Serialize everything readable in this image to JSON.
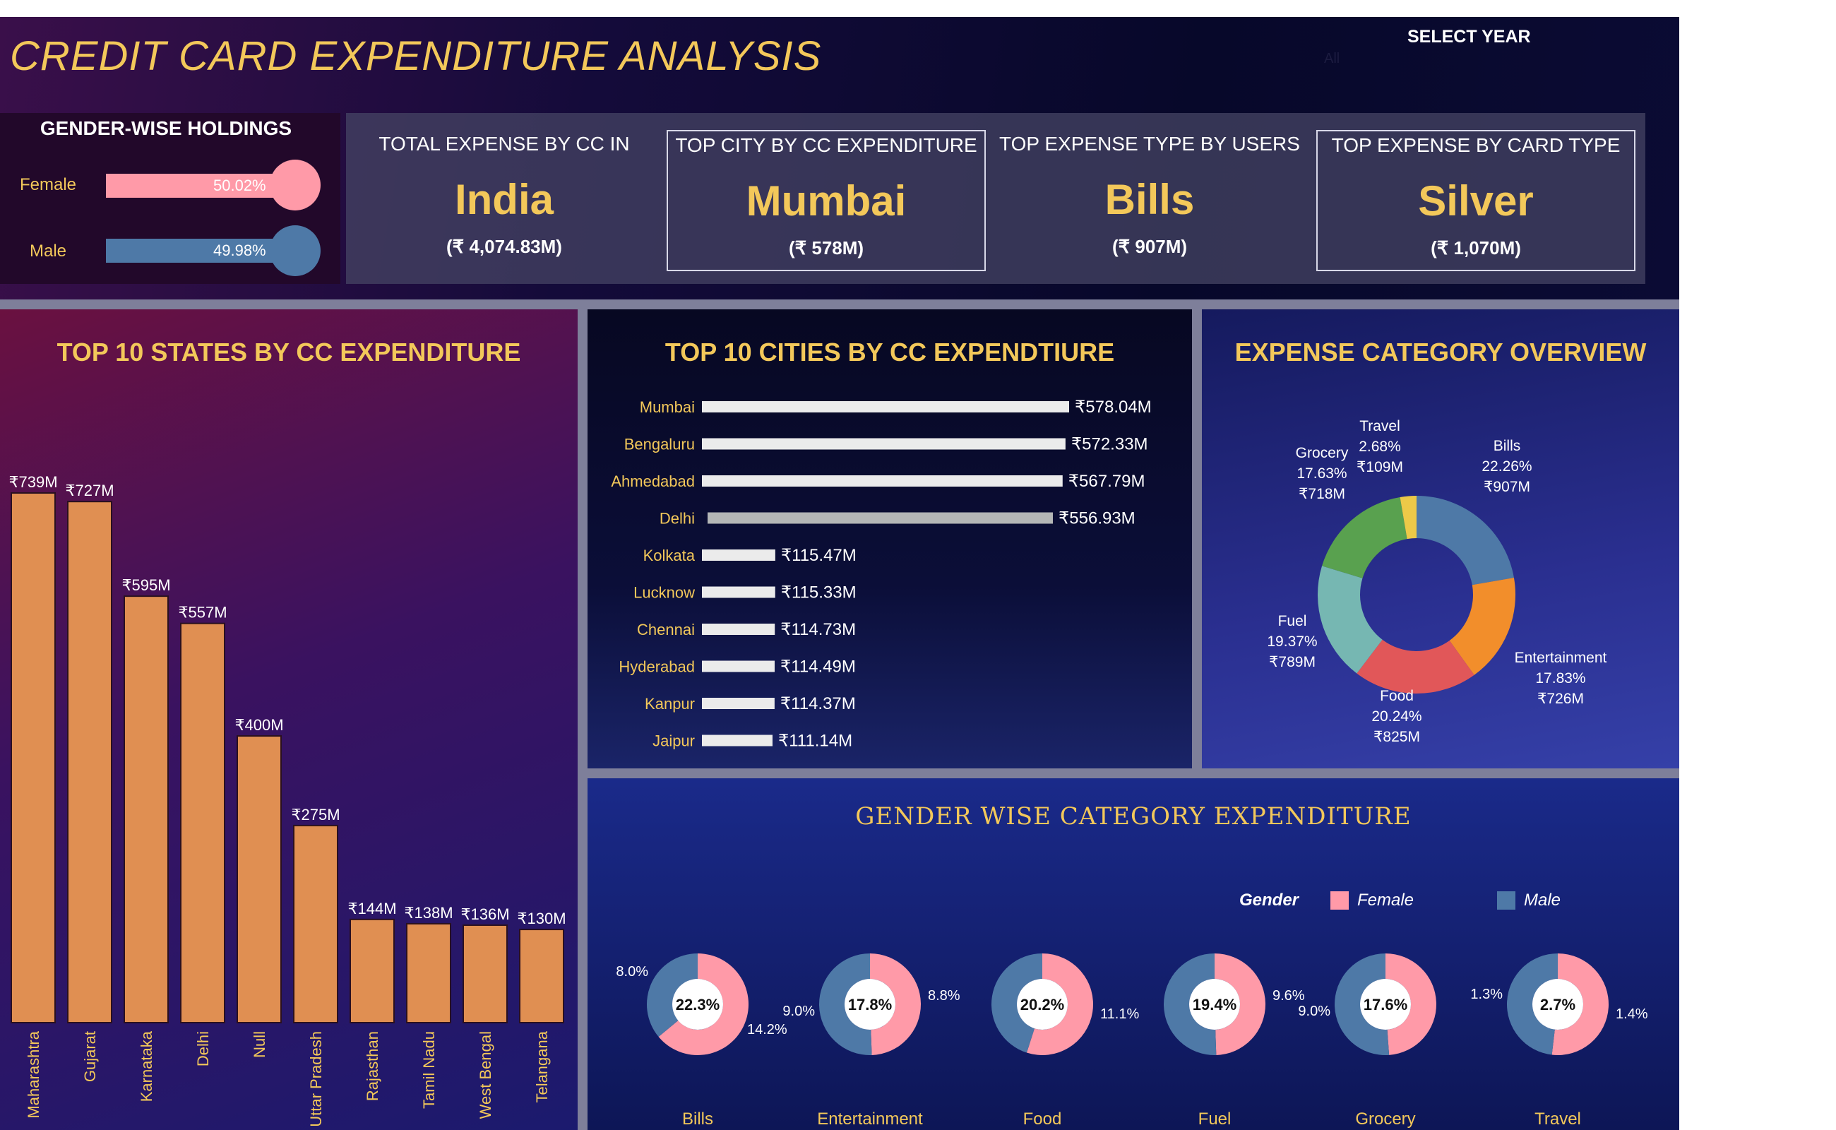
{
  "title": "CREDIT CARD EXPENDITURE ANALYSIS",
  "filter": {
    "label": "SELECT YEAR",
    "value": "All"
  },
  "gender_holdings": {
    "title": "GENDER-WISE HOLDINGS",
    "rows": [
      {
        "label": "Female",
        "pct_text": "50.02%",
        "value": 50.02,
        "color": "#ff9aa8"
      },
      {
        "label": "Male",
        "pct_text": "49.98%",
        "value": 49.98,
        "color": "#4e79a7"
      }
    ]
  },
  "kpis": [
    {
      "title": "TOTAL EXPENSE BY CC IN",
      "value": "India",
      "sub": "(₹ 4,074.83M)"
    },
    {
      "title": "TOP CITY BY CC EXPENDITURE",
      "value": "Mumbai",
      "sub": "(₹ 578M)"
    },
    {
      "title": "TOP EXPENSE TYPE BY USERS",
      "value": "Bills",
      "sub": "(₹ 907M)"
    },
    {
      "title": "TOP EXPENSE BY CARD TYPE",
      "value": "Silver",
      "sub": "(₹ 1,070M)"
    }
  ],
  "chart_data": [
    {
      "type": "bar",
      "title": "TOP 10 STATES BY CC EXPENDITURE",
      "categories": [
        "Maharashtra",
        "Gujarat",
        "Karnataka",
        "Delhi",
        "Null",
        "Uttar Pradesh",
        "Rajasthan",
        "Tamil Nadu",
        "West Bengal",
        "Telangana"
      ],
      "values": [
        739,
        727,
        595,
        557,
        400,
        275,
        144,
        138,
        136,
        130
      ],
      "labels": [
        "₹739M",
        "₹727M",
        "₹595M",
        "₹557M",
        "₹400M",
        "₹275M",
        "₹144M",
        "₹138M",
        "₹136M",
        "₹130M"
      ],
      "unit": "₹M",
      "color": "#e08f52"
    },
    {
      "type": "bar",
      "orientation": "horizontal",
      "title": "TOP 10 CITIES BY CC EXPENDTIURE",
      "categories": [
        "Mumbai",
        "Bengaluru",
        "Ahmedabad",
        "Delhi",
        "Kolkata",
        "Lucknow",
        "Chennai",
        "Hyderabad",
        "Kanpur",
        "Jaipur"
      ],
      "values": [
        578.04,
        572.33,
        567.79,
        556.93,
        115.47,
        115.33,
        114.73,
        114.49,
        114.37,
        111.14
      ],
      "labels": [
        "₹578.04M",
        "₹572.33M",
        "₹567.79M",
        "₹556.93M",
        "₹115.47M",
        "₹115.33M",
        "₹114.73M",
        "₹114.49M",
        "₹114.37M",
        "₹111.14M"
      ],
      "unit": "₹M",
      "color": "#ebebeb",
      "highlight_color": "#b4b6b6"
    },
    {
      "type": "pie",
      "title": "EXPENSE CATEGORY OVERVIEW",
      "slices": [
        {
          "name": "Bills",
          "pct": "22.26%",
          "amount": "₹907M",
          "value": 907,
          "color": "#4e79a7"
        },
        {
          "name": "Entertainment",
          "pct": "17.83%",
          "amount": "₹726M",
          "value": 726,
          "color": "#f28e2b"
        },
        {
          "name": "Food",
          "pct": "20.24%",
          "amount": "₹825M",
          "value": 825,
          "color": "#e15759"
        },
        {
          "name": "Fuel",
          "pct": "19.37%",
          "amount": "₹789M",
          "value": 789,
          "color": "#76b7b2"
        },
        {
          "name": "Grocery",
          "pct": "17.63%",
          "amount": "₹718M",
          "value": 718,
          "color": "#59a14f"
        },
        {
          "name": "Travel",
          "pct": "2.68%",
          "amount": "₹109M",
          "value": 109,
          "color": "#edc948"
        }
      ]
    },
    {
      "type": "pie",
      "title": "GENDER WISE CATEGORY EXPENDITURE",
      "legend": {
        "title": "Gender",
        "items": [
          {
            "name": "Female",
            "color": "#ff9aa8"
          },
          {
            "name": "Male",
            "color": "#4e79a7"
          }
        ]
      },
      "donuts": [
        {
          "category": "Bills",
          "center": "22.3%",
          "female": 14.2,
          "male": 8.0,
          "female_label": "14.2%",
          "male_label": "8.0%"
        },
        {
          "category": "Entertainment",
          "center": "17.8%",
          "female": 8.8,
          "male": 9.0,
          "female_label": "8.8%",
          "male_label": "9.0%"
        },
        {
          "category": "Food",
          "center": "20.2%",
          "female": 11.1,
          "male": 9.1,
          "female_label": "11.1%",
          "male_label": ""
        },
        {
          "category": "Fuel",
          "center": "19.4%",
          "female": 9.6,
          "male": 9.8,
          "female_label": "9.6%",
          "male_label": ""
        },
        {
          "category": "Grocery",
          "center": "17.6%",
          "female": 8.6,
          "male": 9.0,
          "female_label": "",
          "male_label": "9.0%"
        },
        {
          "category": "Travel",
          "center": "2.7%",
          "female": 1.4,
          "male": 1.3,
          "female_label": "1.4%",
          "male_label": "1.3%"
        }
      ]
    }
  ]
}
